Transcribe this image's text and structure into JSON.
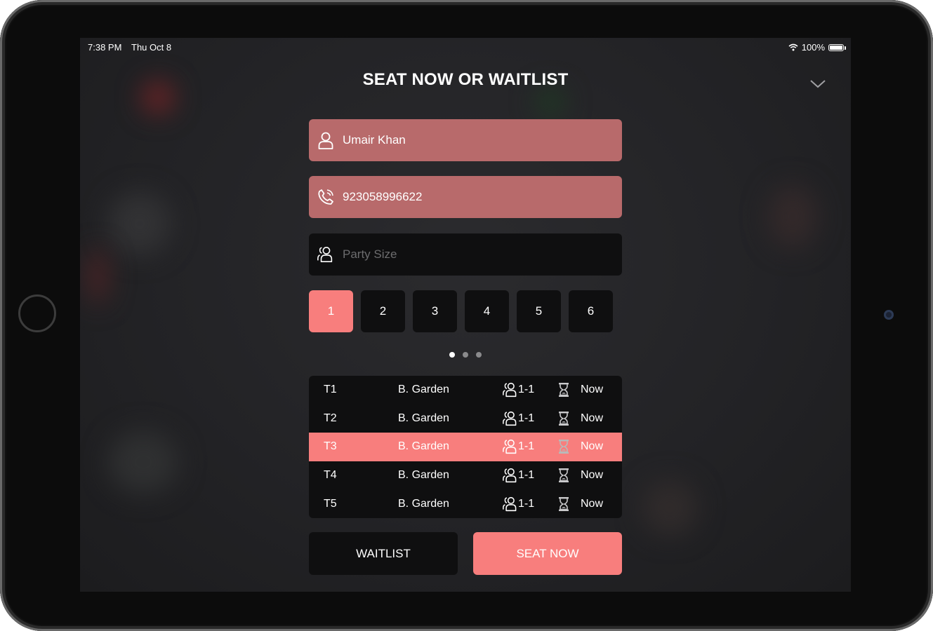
{
  "status_bar": {
    "time": "7:38 PM",
    "date": "Thu Oct 8",
    "battery": "100%",
    "battery_level": 1.0
  },
  "page": {
    "title": "SEAT NOW OR WAITLIST"
  },
  "form": {
    "name_value": "Umair Khan",
    "phone_value": "923058996622",
    "party_size_placeholder": "Party Size"
  },
  "party_sizes": [
    "1",
    "2",
    "3",
    "4",
    "5",
    "6"
  ],
  "selected_party_size": "1",
  "pager": {
    "pages": 3,
    "current": 1
  },
  "tables": [
    {
      "id": "T1",
      "section": "B. Garden",
      "party": "1-1",
      "wait": "Now",
      "selected": false
    },
    {
      "id": "T2",
      "section": "B. Garden",
      "party": "1-1",
      "wait": "Now",
      "selected": false
    },
    {
      "id": "T3",
      "section": "B. Garden",
      "party": "1-1",
      "wait": "Now",
      "selected": true
    },
    {
      "id": "T4",
      "section": "B. Garden",
      "party": "1-1",
      "wait": "Now",
      "selected": false
    },
    {
      "id": "T5",
      "section": "B. Garden",
      "party": "1-1",
      "wait": "Now",
      "selected": false
    }
  ],
  "actions": {
    "waitlist_label": "WAITLIST",
    "seat_now_label": "SEAT NOW"
  },
  "icons": {
    "name": "person-icon",
    "phone": "phone-icon",
    "party": "group-icon",
    "collapse": "chevron-down-icon",
    "wait": "hourglass-icon",
    "wifi": "wifi-icon",
    "battery": "battery-icon"
  },
  "colors": {
    "accent": "#f87e7d",
    "filled_field": "#b86a6b",
    "panel": "#0f0f10",
    "text": "#ffffff",
    "placeholder": "#6c6c6e"
  }
}
